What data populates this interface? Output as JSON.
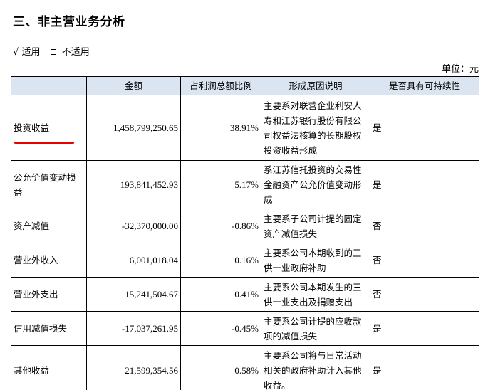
{
  "heading": "三、非主营业务分析",
  "options": {
    "applicable_mark": "√",
    "applicable": "适用",
    "not_applicable": "不适用"
  },
  "unit": "单位：元",
  "table": {
    "headers": [
      "",
      "金额",
      "占利润总额比例",
      "形成原因说明",
      "是否具有可持续性"
    ],
    "rows": [
      {
        "label": "投资收益",
        "amount": "1,458,799,250.65",
        "ratio": "38.91%",
        "reason": "主要系对联营企业利安人寿和江苏银行股份有限公司权益法核算的长期股权投资收益形成",
        "sustainable": "是"
      },
      {
        "label": "公允价值变动损益",
        "amount": "193,841,452.93",
        "ratio": "5.17%",
        "reason": "系江苏信托投资的交易性金融资产公允价值变动形成",
        "sustainable": "是"
      },
      {
        "label": "资产减值",
        "amount": "-32,370,000.00",
        "ratio": "-0.86%",
        "reason": "主要系子公司计提的固定资产减值损失",
        "sustainable": "否"
      },
      {
        "label": "营业外收入",
        "amount": "6,001,018.04",
        "ratio": "0.16%",
        "reason": "主要系公司本期收到的三供一业政府补助",
        "sustainable": "否"
      },
      {
        "label": "营业外支出",
        "amount": "15,241,504.67",
        "ratio": "0.41%",
        "reason": "主要系公司本期发生的三供一业支出及捐赠支出",
        "sustainable": "否"
      },
      {
        "label": "信用减值损失",
        "amount": "-17,037,261.95",
        "ratio": "-0.45%",
        "reason": "主要系公司计提的应收款项的减值损失",
        "sustainable": "是"
      },
      {
        "label": "其他收益",
        "amount": "21,599,354.56",
        "ratio": "0.58%",
        "reason": "主要系公司将与日常活动相关的政府补助计入其他收益。",
        "sustainable": "是"
      }
    ]
  },
  "annotation_color": "#e60000"
}
